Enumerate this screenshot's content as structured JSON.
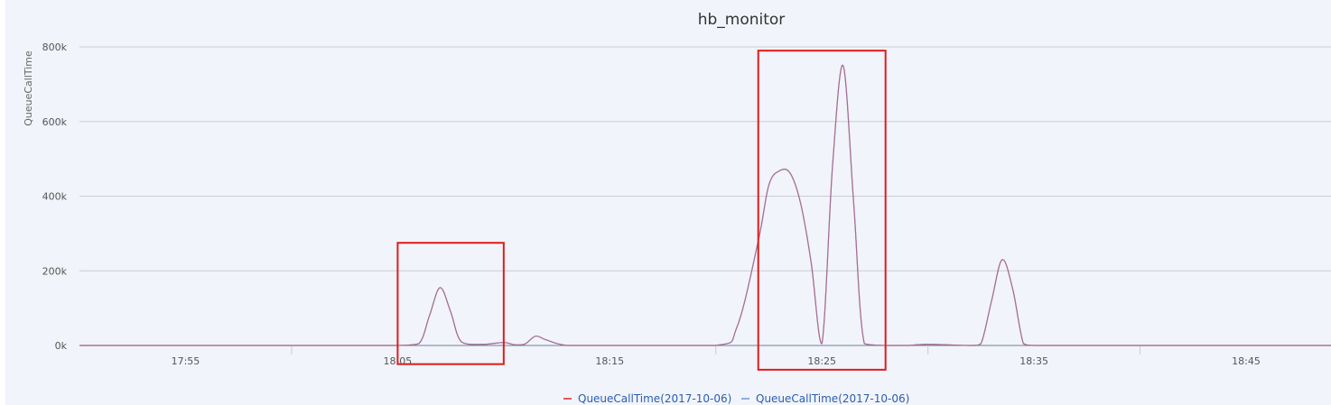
{
  "chart_data": {
    "type": "line",
    "title": "hb_monitor",
    "ylabel": "QueueCallTime",
    "xlabel": "",
    "ylim": [
      0,
      800000
    ],
    "xlim_minutes": [
      "17:50",
      "18:49"
    ],
    "yticks": [
      0,
      200000,
      400000,
      600000,
      800000
    ],
    "ytick_labels": [
      "0k",
      "200k",
      "400k",
      "600k",
      "800k"
    ],
    "xtick_labels": [
      "17:55",
      "18:05",
      "18:15",
      "18:25",
      "18:35",
      "18:45"
    ],
    "grid": "horizontal",
    "legend_position": "bottom-center",
    "series": [
      {
        "name": "QueueCallTime(2017-10-06)",
        "color": "#e8232d",
        "x": [
          "17:50",
          "17:55",
          "18:00",
          "18:04",
          "18:05",
          "18:06",
          "18:06:30",
          "18:07",
          "18:07:30",
          "18:08",
          "18:09",
          "18:10",
          "18:10:30",
          "18:11",
          "18:11:30",
          "18:12",
          "18:13",
          "18:15",
          "18:20",
          "18:21",
          "18:22",
          "18:22:30",
          "18:23",
          "18:23:30",
          "18:24",
          "18:24:30",
          "18:25",
          "18:25:30",
          "18:26",
          "18:26:30",
          "18:27",
          "18:28",
          "18:29",
          "18:30",
          "18:32",
          "18:32:30",
          "18:33",
          "18:33:30",
          "18:34",
          "18:34:30",
          "18:35",
          "18:36",
          "18:40",
          "18:45",
          "18:49"
        ],
        "values": [
          0,
          0,
          0,
          0,
          0,
          5000,
          80000,
          155000,
          90000,
          10000,
          3000,
          8000,
          2000,
          4000,
          25000,
          15000,
          0,
          0,
          0,
          50000,
          280000,
          430000,
          468000,
          462000,
          380000,
          220000,
          5000,
          480000,
          750000,
          380000,
          5000,
          0,
          0,
          3000,
          0,
          5000,
          120000,
          230000,
          150000,
          5000,
          0,
          0,
          0,
          0,
          0
        ]
      },
      {
        "name": "QueueCallTime(2017-10-06)",
        "color": "#6d97d6",
        "x": [
          "17:50",
          "17:55",
          "18:00",
          "18:04",
          "18:05",
          "18:06",
          "18:06:30",
          "18:07",
          "18:07:30",
          "18:08",
          "18:09",
          "18:10",
          "18:10:30",
          "18:11",
          "18:11:30",
          "18:12",
          "18:13",
          "18:15",
          "18:20",
          "18:21",
          "18:22",
          "18:22:30",
          "18:23",
          "18:23:30",
          "18:24",
          "18:24:30",
          "18:25",
          "18:25:30",
          "18:26",
          "18:26:30",
          "18:27",
          "18:28",
          "18:29",
          "18:30",
          "18:32",
          "18:32:30",
          "18:33",
          "18:33:30",
          "18:34",
          "18:34:30",
          "18:35",
          "18:36",
          "18:40",
          "18:45",
          "18:49"
        ],
        "values": [
          0,
          0,
          0,
          0,
          0,
          5000,
          80000,
          155000,
          90000,
          10000,
          3000,
          8000,
          2000,
          4000,
          25000,
          15000,
          0,
          0,
          0,
          50000,
          280000,
          430000,
          468000,
          462000,
          380000,
          220000,
          5000,
          480000,
          750000,
          380000,
          5000,
          0,
          0,
          3000,
          0,
          5000,
          120000,
          230000,
          150000,
          5000,
          0,
          0,
          0,
          0,
          0
        ]
      }
    ],
    "highlight_boxes": [
      {
        "x_range": [
          "18:05",
          "18:10"
        ],
        "y_range": [
          -50000,
          275000
        ],
        "color": "#e01b1b"
      },
      {
        "x_range": [
          "18:22",
          "18:28"
        ],
        "y_range": [
          -65000,
          790000
        ],
        "color": "#e01b1b"
      }
    ]
  }
}
